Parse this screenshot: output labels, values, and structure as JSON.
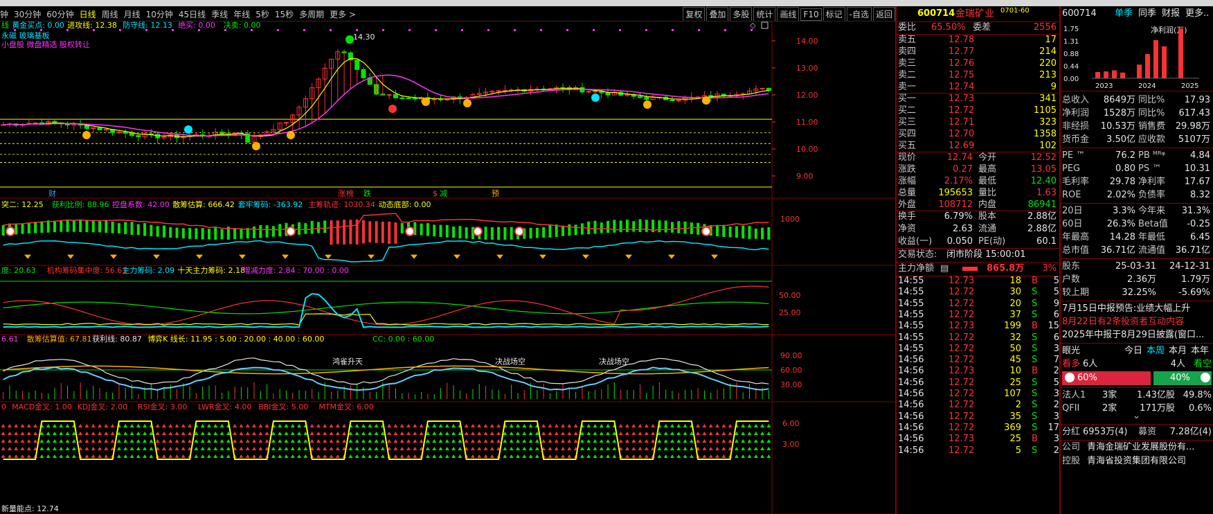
{
  "toolbar": {
    "periods": [
      "钟",
      "30分钟",
      "60分钟",
      "日线",
      "周线",
      "月线",
      "10分钟",
      "45日线",
      "季线",
      "年线",
      "5秒",
      "15秒",
      "多周期",
      "更多 >"
    ],
    "active_period": "日线",
    "tools": [
      "复权",
      "叠加",
      "多股",
      "统计",
      "画线",
      "F10",
      "标记",
      "-自选",
      "返回"
    ]
  },
  "chart": {
    "main_line1": [
      {
        "t": "线",
        "c": "#00e600"
      },
      {
        "t": "黄金买点: 0.00",
        "c": "#00e5ff"
      },
      {
        "t": "进攻线: 12.38",
        "c": "#ffff00"
      },
      {
        "t": "防守线: 12.13",
        "c": "#00e5ff"
      },
      {
        "t": "绝买: 0.00",
        "c": "#ff33ff"
      },
      {
        "t": "决卖: 0.00",
        "c": "#00e600"
      }
    ],
    "main_line2": "永磁 玻璃基板",
    "main_line3": "小盘股 微盘精选 股权转让",
    "high_label": "14.30",
    "main_yticks": [
      "14.00",
      "13.00",
      "12.00",
      "11.00",
      "10.00",
      "9.00"
    ],
    "event_labels": [
      {
        "t": "财",
        "c": "#3399ff"
      },
      {
        "t": "涨",
        "c": "#ff3232"
      },
      {
        "t": "榜",
        "c": "#ff3232"
      },
      {
        "t": "跌",
        "c": "#00e600"
      },
      {
        "t": "$",
        "c": "#ff3232"
      },
      {
        "t": "减",
        "c": "#00e600"
      },
      {
        "t": "预",
        "c": "#ffb000"
      }
    ],
    "ind1_line": [
      {
        "t": "突二: 12.25",
        "c": "#ffff00"
      },
      {
        "t": "获利比例: 88.96",
        "c": "#00e600"
      },
      {
        "t": "控盘系数: 42.00",
        "c": "#ff33ff"
      },
      {
        "t": "散筹估算: 666.42",
        "c": "#ffff00"
      },
      {
        "t": "套牢筹码: -363.92",
        "c": "#00e5ff"
      },
      {
        "t": "主筹轨迹: 1030.34",
        "c": "#ff3232"
      },
      {
        "t": "动态底部: 0.00",
        "c": "#ffff00"
      }
    ],
    "ind1_yticks": [
      "1000"
    ],
    "ind2_line": [
      {
        "t": "度: 20.63",
        "c": "#00e600"
      },
      {
        "t": "机构筹码集中度: 56.61",
        "c": "#ff3232"
      },
      {
        "t": "主力筹码: 2.09",
        "c": "#00e5ff"
      },
      {
        "t": "十天主力筹码: 2.18",
        "c": "#ffff00"
      },
      {
        "t": "增减力度: 2.84 : 70.00 : 0.00",
        "c": "#ff33ff"
      }
    ],
    "ind2_yticks": [
      "50.00",
      "25.00"
    ],
    "ind3_line": [
      {
        "t": "6.61",
        "c": "#ff33ff"
      },
      {
        "t": "散筹估算值: 67.81",
        "c": "#ffb000"
      },
      {
        "t": "获利线: 80.87",
        "c": "#e6e6e6"
      },
      {
        "t": "博弈K 线长: 11.95 : 5.00 : 20.00 : 40.00 : 60.00",
        "c": "#ffff00"
      },
      {
        "t": "CC: 0.00 : 60.00",
        "c": "#00e600"
      }
    ],
    "ind3_yticks": [
      "90.00",
      "60.00",
      "30.00"
    ],
    "ind3_annotations": [
      "鸿雀升天",
      "决战场空",
      "决战场空"
    ],
    "ind4_line": [
      {
        "t": "0",
        "c": "#ff3232"
      },
      {
        "t": "MACD金叉: 1.00",
        "c": "#ff3232"
      },
      {
        "t": "KDJ金叉: 2.00",
        "c": "#ff3232"
      },
      {
        "t": "RSI金叉: 3.00",
        "c": "#ff3232"
      },
      {
        "t": "LWR金叉: 4.00",
        "c": "#ff3232"
      },
      {
        "t": "BBI金叉: 5.00",
        "c": "#ff3232"
      },
      {
        "t": "MTM金叉: 6.00",
        "c": "#ff3232"
      }
    ],
    "ind4_yticks": [
      "6.00",
      "3.00"
    ],
    "bottom_label": "新量能点: 12.74"
  },
  "quote": {
    "code": "600714",
    "name": "金瑞矿业",
    "tag": "0701-60",
    "webi_label": "委比",
    "webi_value": "65.50%",
    "weicha_label": "委差",
    "weicha_value": "2556",
    "sells": [
      {
        "label": "卖五",
        "price": "12.78",
        "vol": "17"
      },
      {
        "label": "卖四",
        "price": "12.77",
        "vol": "214"
      },
      {
        "label": "卖三",
        "price": "12.76",
        "vol": "220"
      },
      {
        "label": "卖二",
        "price": "12.75",
        "vol": "213"
      },
      {
        "label": "卖一",
        "price": "12.74",
        "vol": "9"
      }
    ],
    "buys": [
      {
        "label": "买一",
        "price": "12.73",
        "vol": "341"
      },
      {
        "label": "买二",
        "price": "12.72",
        "vol": "1105"
      },
      {
        "label": "买三",
        "price": "12.71",
        "vol": "323"
      },
      {
        "label": "买四",
        "price": "12.70",
        "vol": "1358"
      },
      {
        "label": "买五",
        "price": "12.69",
        "vol": "102"
      }
    ],
    "stats": [
      {
        "l1": "现价",
        "v1": "12.74",
        "c1": "red",
        "l2": "今开",
        "v2": "12.52",
        "c2": "red"
      },
      {
        "l1": "涨跌",
        "v1": "0.27",
        "c1": "red",
        "l2": "最高",
        "v2": "13.05",
        "c2": "red"
      },
      {
        "l1": "涨幅",
        "v1": "2.17%",
        "c1": "red",
        "l2": "最低",
        "v2": "12.40",
        "c2": "grn"
      },
      {
        "l1": "总量",
        "v1": "195653",
        "c1": "yel",
        "l2": "量比",
        "v2": "1.63",
        "c2": "red"
      },
      {
        "l1": "外盘",
        "v1": "108712",
        "c1": "red",
        "l2": "内盘",
        "v2": "86941",
        "c2": "grn"
      }
    ],
    "stats2": [
      {
        "l1": "换手",
        "v1": "6.79%",
        "l2": "股本",
        "v2": "2.88亿"
      },
      {
        "l1": "净资",
        "v1": "2.63",
        "l2": "流通",
        "v2": "2.88亿"
      },
      {
        "l1": "收益(一)",
        "v1": "0.050",
        "l2": "PE(动)",
        "v2": "60.1"
      }
    ],
    "status_label": "交易状态:",
    "status_value": "闭市阶段 15:00:01",
    "netflow_label": "主力净额",
    "netflow_value": "865.8万",
    "netflow_pct": "3%",
    "ticks": [
      {
        "t": "14:55",
        "p": "12.73",
        "v": "18",
        "s": "B",
        "n": "5"
      },
      {
        "t": "14:55",
        "p": "12.72",
        "v": "30",
        "s": "S",
        "n": "5"
      },
      {
        "t": "14:55",
        "p": "12.72",
        "v": "20",
        "s": "S",
        "n": "9"
      },
      {
        "t": "14:55",
        "p": "12.72",
        "v": "37",
        "s": "S",
        "n": "6"
      },
      {
        "t": "14:55",
        "p": "12.73",
        "v": "199",
        "s": "B",
        "n": "15"
      },
      {
        "t": "14:55",
        "p": "12.72",
        "v": "32",
        "s": "S",
        "n": "6"
      },
      {
        "t": "14:55",
        "p": "12.72",
        "v": "50",
        "s": "S",
        "n": "3"
      },
      {
        "t": "14:56",
        "p": "12.72",
        "v": "45",
        "s": "S",
        "n": "7"
      },
      {
        "t": "14:56",
        "p": "12.73",
        "v": "10",
        "s": "B",
        "n": "2"
      },
      {
        "t": "14:56",
        "p": "12.72",
        "v": "25",
        "s": "S",
        "n": "5"
      },
      {
        "t": "14:56",
        "p": "12.72",
        "v": "107",
        "s": "S",
        "n": "3"
      },
      {
        "t": "14:56",
        "p": "12.72",
        "v": "2",
        "s": "S",
        "n": "2"
      },
      {
        "t": "14:56",
        "p": "12.72",
        "v": "35",
        "s": "S",
        "n": "3"
      },
      {
        "t": "14:56",
        "p": "12.72",
        "v": "369",
        "s": "S",
        "n": "17"
      },
      {
        "t": "14:56",
        "p": "12.73",
        "v": "25",
        "s": "B",
        "n": "3"
      },
      {
        "t": "14:56",
        "p": "12.72",
        "v": "5",
        "s": "S",
        "n": "2"
      }
    ]
  },
  "fin": {
    "code": "600714",
    "tabs": [
      "单季",
      "同季",
      "财报",
      "更多.."
    ],
    "active_tab": "单季",
    "mini_chart": {
      "title": "净利润(万)",
      "yticks": [
        "1.75",
        "1.31",
        "0.88",
        "0.44",
        "0.00"
      ],
      "xticks": [
        "2023",
        "2024",
        "2025"
      ],
      "values": [
        0.22,
        0.24,
        0.28,
        0.2,
        0.0,
        0.48,
        0.85,
        1.34,
        1.12,
        0.0,
        1.75
      ]
    },
    "metrics1": [
      {
        "l": "总收入",
        "v": "8649万",
        "l2": "同比%",
        "v2": "17.93"
      },
      {
        "l": "净利润",
        "v": "1528万",
        "l2": "同比%",
        "v2": "617.43"
      },
      {
        "l": "非经损",
        "v": "10.53万",
        "l2": "销售费",
        "v2": "29.98万"
      },
      {
        "l": "货币金",
        "v": "3.50亿",
        "l2": "应收款",
        "v2": "5107万"
      }
    ],
    "metrics2": [
      {
        "l": "PE ™",
        "v": "76.2",
        "l2": "PB ᴹᴿᵠ",
        "v2": "4.84"
      },
      {
        "l": "PEG",
        "v": "0.80",
        "l2": "PS ™",
        "v2": "10.31"
      },
      {
        "l": "毛利率",
        "v": "29.78",
        "l2": "净利率",
        "v2": "17.67"
      },
      {
        "l": "ROE",
        "v": "2.02%",
        "l2": "负债率",
        "v2": "8.32"
      }
    ],
    "metrics3": [
      {
        "l": "20日",
        "v": "3.3%",
        "l2": "今年来",
        "v2": "31.3%"
      },
      {
        "l": "60日",
        "v": "26.3%",
        "l2": "Beta值",
        "v2": "-0.25"
      },
      {
        "l": "年最高",
        "v": "14.28",
        "l2": "年最低",
        "v2": "6.45"
      },
      {
        "l": "总市值",
        "v": "36.71亿",
        "l2": "流通值",
        "v2": "36.71亿"
      }
    ],
    "holders": [
      {
        "l": "股东",
        "v": "25-03-31",
        "v2": "24-12-31"
      },
      {
        "l": "户数",
        "v": "2.36万",
        "v2": "1.79万"
      },
      {
        "l": "较上期",
        "v": "32.25%",
        "v2": "-5.69%"
      }
    ],
    "news": [
      {
        "t": "7月15日中报预告:业绩大幅上升",
        "c": "#e6e6e6"
      },
      {
        "t": "8月22日有2条投资者互动内容",
        "c": "#ff3232"
      },
      {
        "t": "2025年中报于8月29日披露(窗口...",
        "c": "#e6e6e6"
      }
    ],
    "eye_label": "眼光",
    "eye_tabs": [
      "今日",
      "本周",
      "本月",
      "本年"
    ],
    "eye_active": "本周",
    "bull_label": "看多",
    "bull_count": "6人",
    "bear_count": "4人",
    "bear_label": "看空",
    "bull_pct": "60%",
    "bear_pct": "40%",
    "inst": [
      {
        "l": "法人1",
        "v": "3家",
        "v2": "1.43亿股",
        "v3": "49.8%"
      },
      {
        "l": "QFII",
        "v": "2家",
        "v2": "171万股",
        "v3": "0.6%"
      }
    ],
    "dividend_label": "分红",
    "dividend_value": "6953万(4)",
    "raise_label": "募资",
    "raise_value": "7.28亿(4)",
    "company_label": "公司",
    "company_value": "青海金瑞矿业发展股份有...",
    "ctrl_label": "控股",
    "ctrl_value": "青海省投资集团有限公司"
  }
}
